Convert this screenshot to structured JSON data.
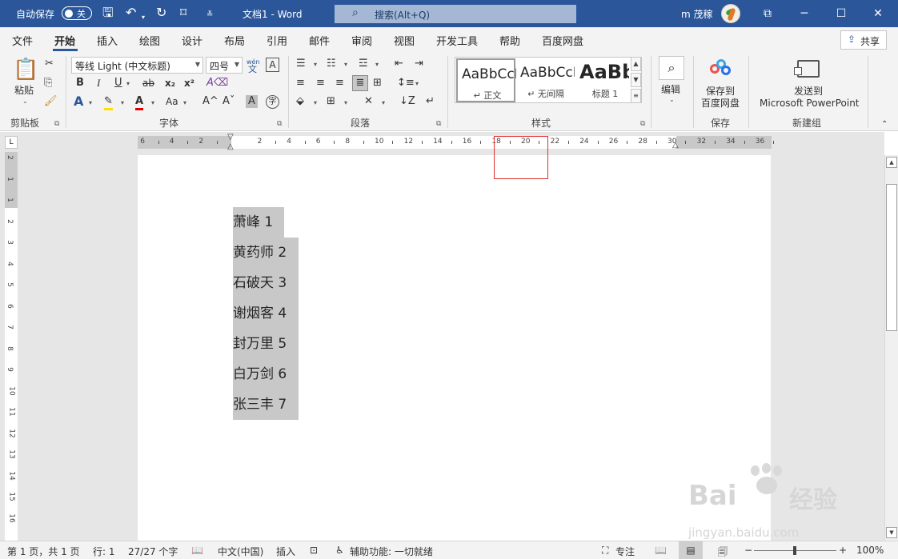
{
  "titlebar": {
    "autosave_label": "自动保存",
    "autosave_state": "关",
    "doc_title": "文档1 - Word",
    "search_placeholder": "搜索(Alt+Q)",
    "user_name": "m 茂稼"
  },
  "tabs": [
    "文件",
    "开始",
    "插入",
    "绘图",
    "设计",
    "布局",
    "引用",
    "邮件",
    "审阅",
    "视图",
    "开发工具",
    "帮助",
    "百度网盘"
  ],
  "active_tab": "开始",
  "share_label": "共享",
  "ribbon": {
    "clipboard": {
      "paste_label": "粘贴",
      "group_label": "剪贴板"
    },
    "font": {
      "font_name": "等线 Light (中文标题)",
      "font_size": "四号",
      "phonetic_label": "wén",
      "phonetic_char": "文",
      "border_char": "A",
      "bold": "B",
      "italic": "I",
      "underline": "U",
      "strike": "ab",
      "subscript": "x₂",
      "superscript": "x²",
      "text_effect": "A",
      "change_case": "Aa",
      "grow": "A^",
      "shrink": "Aˇ",
      "char_shading": "A",
      "enclose": "字",
      "group_label": "字体"
    },
    "paragraph": {
      "group_label": "段落"
    },
    "styles": {
      "items": [
        {
          "preview": "AaBbCcDd",
          "name": "↵ 正文"
        },
        {
          "preview": "AaBbCcDd",
          "name": "↵ 无间隔"
        },
        {
          "preview": "AaBbI",
          "name": "标题 1"
        }
      ],
      "group_label": "样式"
    },
    "editing": {
      "label": "编辑"
    },
    "save": {
      "label_line1": "保存到",
      "label_line2": "百度网盘",
      "group_label": "保存"
    },
    "newgroup": {
      "label_line1": "发送到",
      "label_line2": "Microsoft PowerPoint",
      "group_label": "新建组"
    }
  },
  "ruler": {
    "h_numbers": [
      "6",
      "4",
      "2",
      "2",
      "4",
      "6",
      "8",
      "10",
      "12",
      "14",
      "16",
      "18",
      "20",
      "22",
      "24",
      "26",
      "28",
      "30",
      "32",
      "34",
      "36"
    ],
    "v_numbers": [
      "2",
      "1",
      "1",
      "2",
      "3",
      "4",
      "5",
      "6",
      "7",
      "8",
      "9",
      "10",
      "11",
      "12",
      "13",
      "14",
      "15",
      "16"
    ]
  },
  "document": {
    "lines": [
      "萧峰 1",
      "黄药师 2",
      "石破天 3",
      "谢烟客 4",
      "封万里 5",
      "白万剑 6",
      "张三丰 7"
    ]
  },
  "statusbar": {
    "page": "第 1 页，共 1 页",
    "row": "行: 1",
    "words": "27/27 个字",
    "language": "中文(中国)",
    "insert_mode": "插入",
    "accessibility": "辅助功能: 一切就绪",
    "focus": "专注",
    "zoom": "100%"
  },
  "watermark": {
    "brand": "Bai",
    "brand2": "经验",
    "url": "jingyan.baidu.com"
  },
  "colors": {
    "word_blue": "#2b579a",
    "ribbon_bg": "#f3f3f3",
    "selection": "#c8c8c8"
  }
}
